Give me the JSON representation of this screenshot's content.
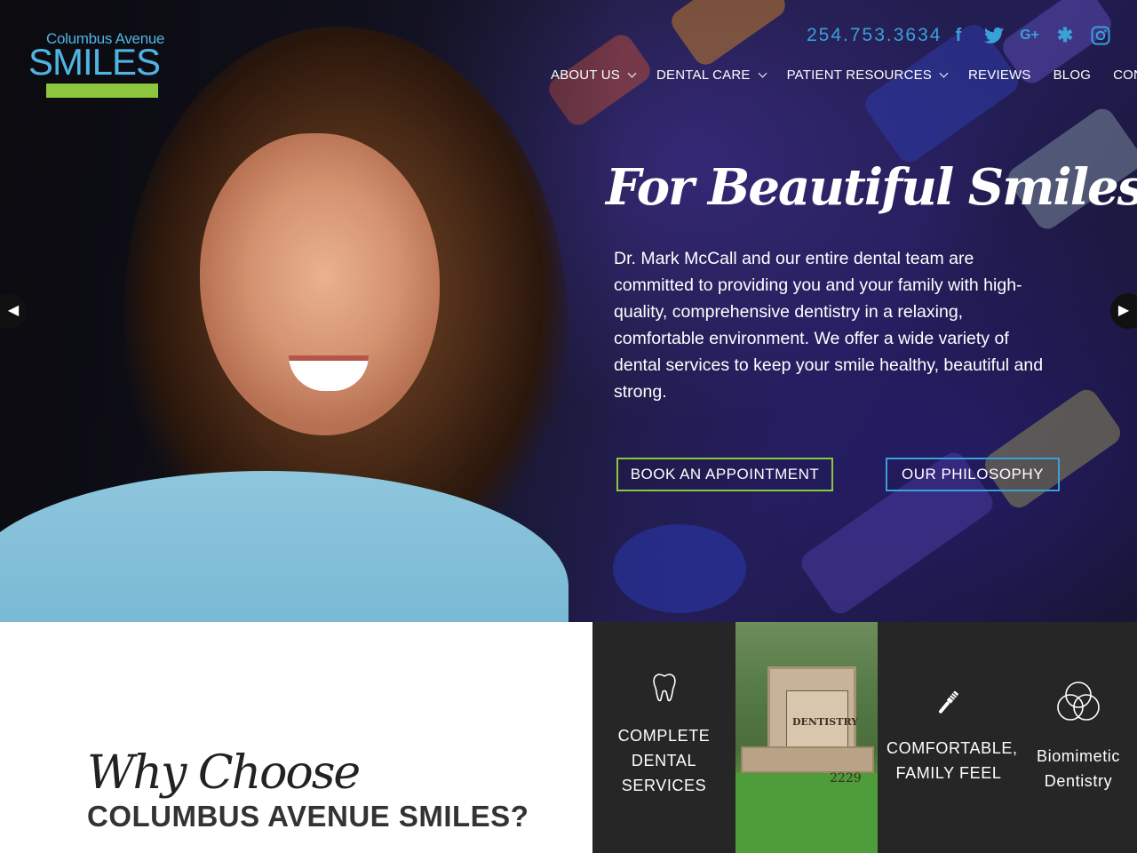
{
  "brand": {
    "logo_top": "Columbus Avenue",
    "logo_main": "SMILES",
    "accent_blue": "#3aa0d8",
    "accent_green": "#8cc63f"
  },
  "header": {
    "phone": "254.753.3634",
    "social": [
      {
        "icon": "facebook-icon",
        "glyph": "f"
      },
      {
        "icon": "twitter-icon",
        "glyph": "t"
      },
      {
        "icon": "google-plus-icon",
        "glyph": "G+"
      },
      {
        "icon": "yelp-icon",
        "glyph": "✱"
      },
      {
        "icon": "instagram-icon",
        "glyph": "◎"
      }
    ],
    "nav": [
      {
        "label": "ABOUT US",
        "dropdown": true
      },
      {
        "label": "DENTAL CARE",
        "dropdown": true
      },
      {
        "label": "PATIENT RESOURCES",
        "dropdown": true
      },
      {
        "label": "REVIEWS",
        "dropdown": false
      },
      {
        "label": "BLOG",
        "dropdown": false
      },
      {
        "label": "CONTACT",
        "dropdown": false
      }
    ]
  },
  "hero": {
    "title": "For Beautiful Smiles ...",
    "text": "Dr. Mark McCall and our entire dental team are committed to providing you and your family with high-quality, comprehensive dentistry in a relaxing, comfortable environment. We offer a wide variety of dental services to keep your smile healthy, beautiful and strong.",
    "btn_book": "BOOK AN APPOINTMENT",
    "btn_philosophy": "OUR PHILOSOPHY",
    "arrow_left_icon": "chevron-left-icon",
    "arrow_right_icon": "chevron-right-icon"
  },
  "why": {
    "script": "Why Choose",
    "main": "COLUMBUS AVENUE SMILES?"
  },
  "features": [
    {
      "icon": "tooth-icon",
      "label": "COMPLETE DENTAL SERVICES"
    },
    {
      "icon": "toothbrush-icon",
      "label": "COMFORTABLE, FAMILY FEEL"
    },
    {
      "icon": "biomimetic-knot-icon",
      "label": "Biomimetic Dentistry"
    }
  ],
  "office_photo": {
    "sign_text": "DENTISTRY",
    "address_number": "2229"
  }
}
